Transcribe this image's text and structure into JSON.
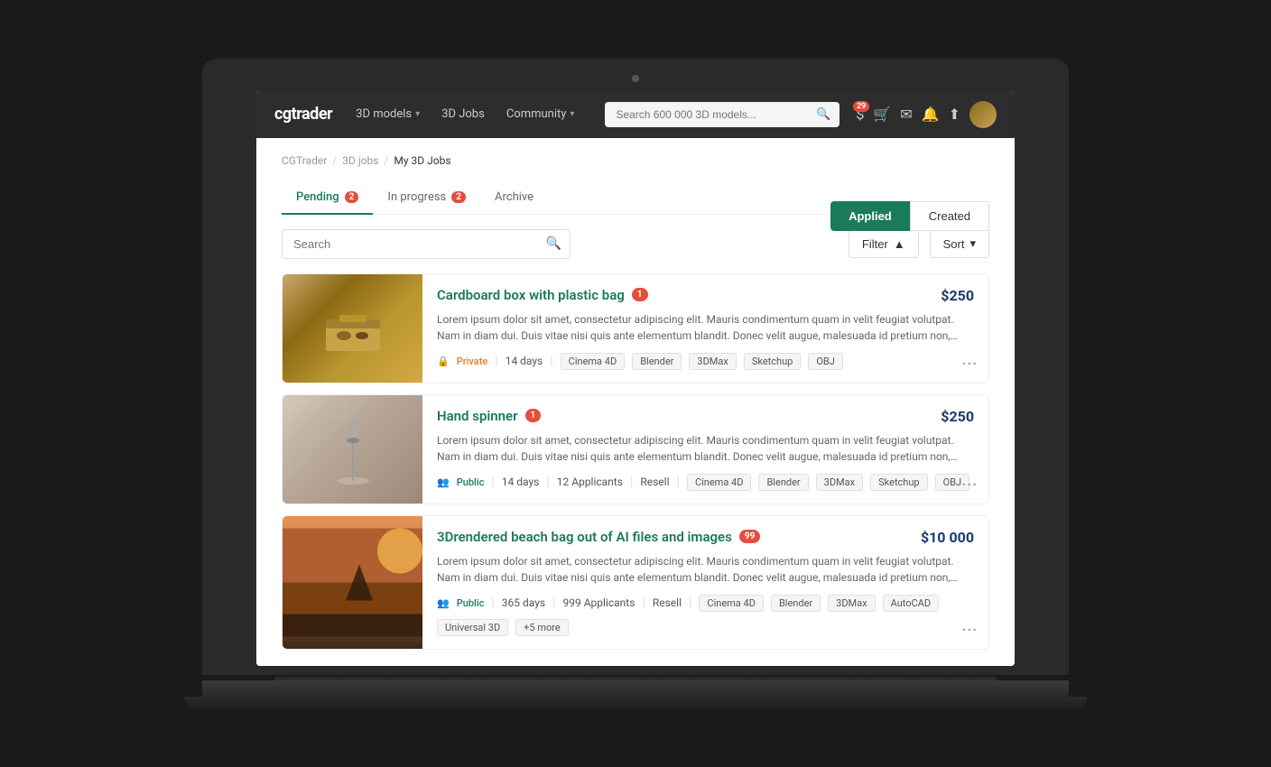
{
  "brand": "cgtrader",
  "nav": {
    "links": [
      {
        "label": "3D models",
        "hasDropdown": true
      },
      {
        "label": "3D Jobs",
        "hasDropdown": false
      },
      {
        "label": "Community",
        "hasDropdown": true
      }
    ],
    "search_placeholder": "Search 600 000 3D models...",
    "badge_count": "29"
  },
  "breadcrumb": {
    "items": [
      "CGTrader",
      "3D jobs",
      "My 3D Jobs"
    ]
  },
  "header_buttons": {
    "applied": "Applied",
    "created": "Created"
  },
  "tabs": [
    {
      "label": "Pending",
      "badge": "2",
      "active": true
    },
    {
      "label": "In progress",
      "badge": "2",
      "active": false
    },
    {
      "label": "Archive",
      "badge": null,
      "active": false
    }
  ],
  "toolbar": {
    "search_placeholder": "Search",
    "filter_label": "Filter",
    "sort_label": "Sort"
  },
  "jobs": [
    {
      "id": 1,
      "title": "Cardboard box with plastic bag",
      "notification": "1",
      "price": "$250",
      "description": "Lorem ipsum dolor sit amet, consectetur adipiscing elit. Mauris condimentum quam in velit feugiat volutpat. Nam in diam dui. Duis vitae nisi quis ante elementum blandit. Donec velit augue, malesuada id pretium non, aliquam quis nisl. Vivamus interdu …",
      "privacy": "Private",
      "privacy_type": "private",
      "days": "14 days",
      "applicants": null,
      "resell": null,
      "tags": [
        "Cinema 4D",
        "Blender",
        "3DMax",
        "Sketchup",
        "OBJ"
      ],
      "thumbnail_type": "cardboard"
    },
    {
      "id": 2,
      "title": "Hand spinner",
      "notification": "1",
      "price": "$250",
      "description": "Lorem ipsum dolor sit amet, consectetur adipiscing elit. Mauris condimentum quam in velit feugiat volutpat. Nam in diam dui. Duis vitae nisi quis ante elementum blandit. Donec velit augue, malesuada id pretium non, aliquam quis nisl. Vivamus interdu …",
      "privacy": "Public",
      "privacy_type": "public",
      "days": "14 days",
      "applicants": "12 Applicants",
      "resell": "Resell",
      "tags": [
        "Cinema 4D",
        "Blender",
        "3DMax",
        "Sketchup",
        "OBJ"
      ],
      "thumbnail_type": "spinner"
    },
    {
      "id": 3,
      "title": "3Drendered beach bag out of AI files and images",
      "notification": "99",
      "price": "$10 000",
      "description": "Lorem ipsum dolor sit amet, consectetur adipiscing elit. Mauris condimentum quam in velit feugiat volutpat. Nam in diam dui. Duis vitae nisi quis ante elementum blandit. Donec velit augue, malesuada id pretium non, aliquam quis nisl. Vivamus interdu …",
      "privacy": "Public",
      "privacy_type": "public",
      "days": "365 days",
      "applicants": "999 Applicants",
      "resell": "Resell",
      "tags": [
        "Cinema 4D",
        "Blender",
        "3DMax",
        "AutoCAD",
        "Universal 3D",
        "+5 more"
      ],
      "thumbnail_type": "beach"
    }
  ]
}
